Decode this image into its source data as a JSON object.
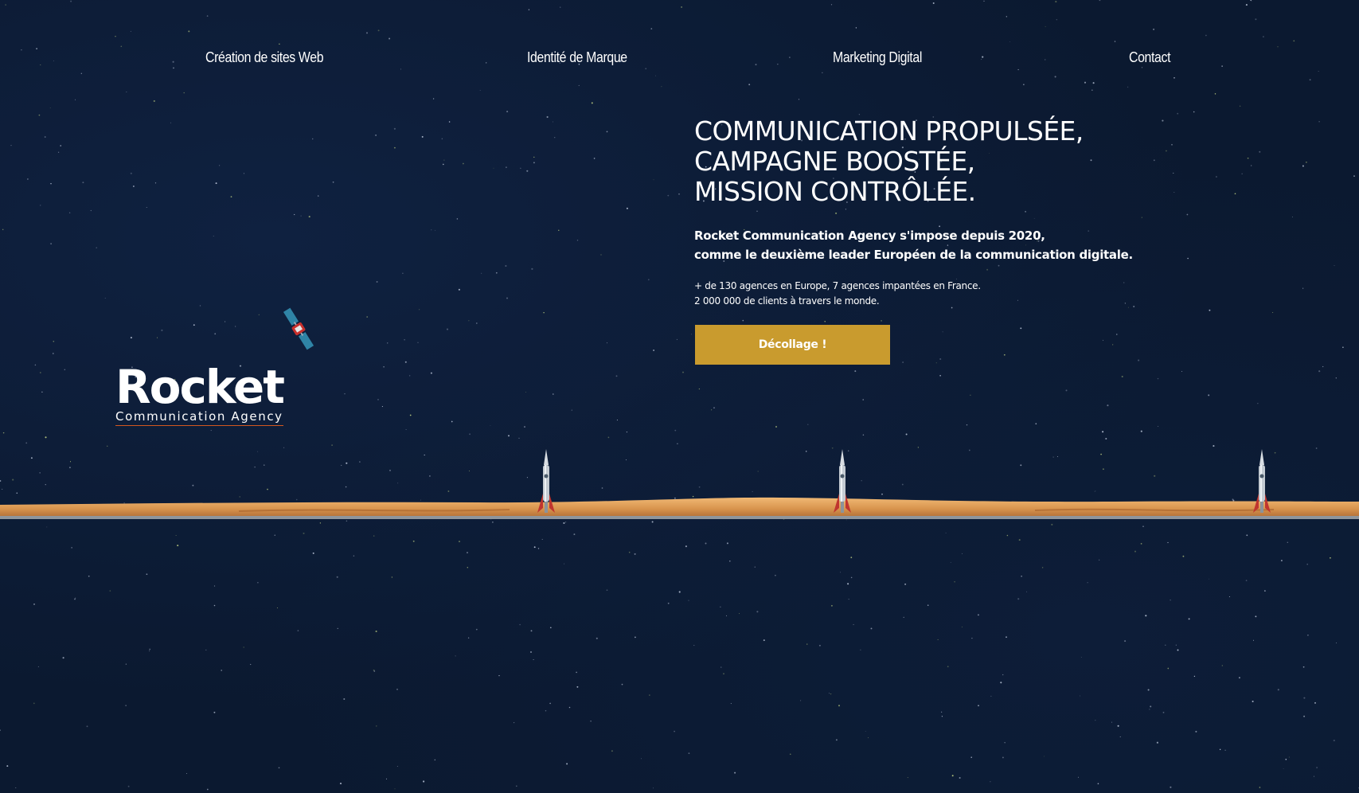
{
  "nav": {
    "items": [
      {
        "label": "Création de sites Web"
      },
      {
        "label": "Identité de Marque"
      },
      {
        "label": "Marketing Digital"
      },
      {
        "label": "Contact"
      }
    ]
  },
  "logo": {
    "word": "Rocket",
    "tagline": "Communication Agency"
  },
  "hero": {
    "title_lines": [
      "COMMUNICATION PROPULSÉE,",
      "CAMPAGNE BOOSTÉE,",
      "MISSION CONTRÔLÉE."
    ],
    "subtitle_lines": [
      "Rocket Communication Agency s'impose depuis 2020,",
      "comme le deuxième leader Européen de la communication digitale."
    ],
    "stats_lines": [
      "+ de 130 agences en Europe, 7 agences impantées en France.",
      "2 000 000 de clients à travers le monde."
    ],
    "cta_label": "Décollage !"
  },
  "colors": {
    "background": "#0b1930",
    "cta": "#c99b2e",
    "sand": "#e0a35c",
    "logo_underline": "#d3561e"
  },
  "icons": {
    "satellite": "satellite-icon",
    "rocket": "rocket-icon"
  }
}
